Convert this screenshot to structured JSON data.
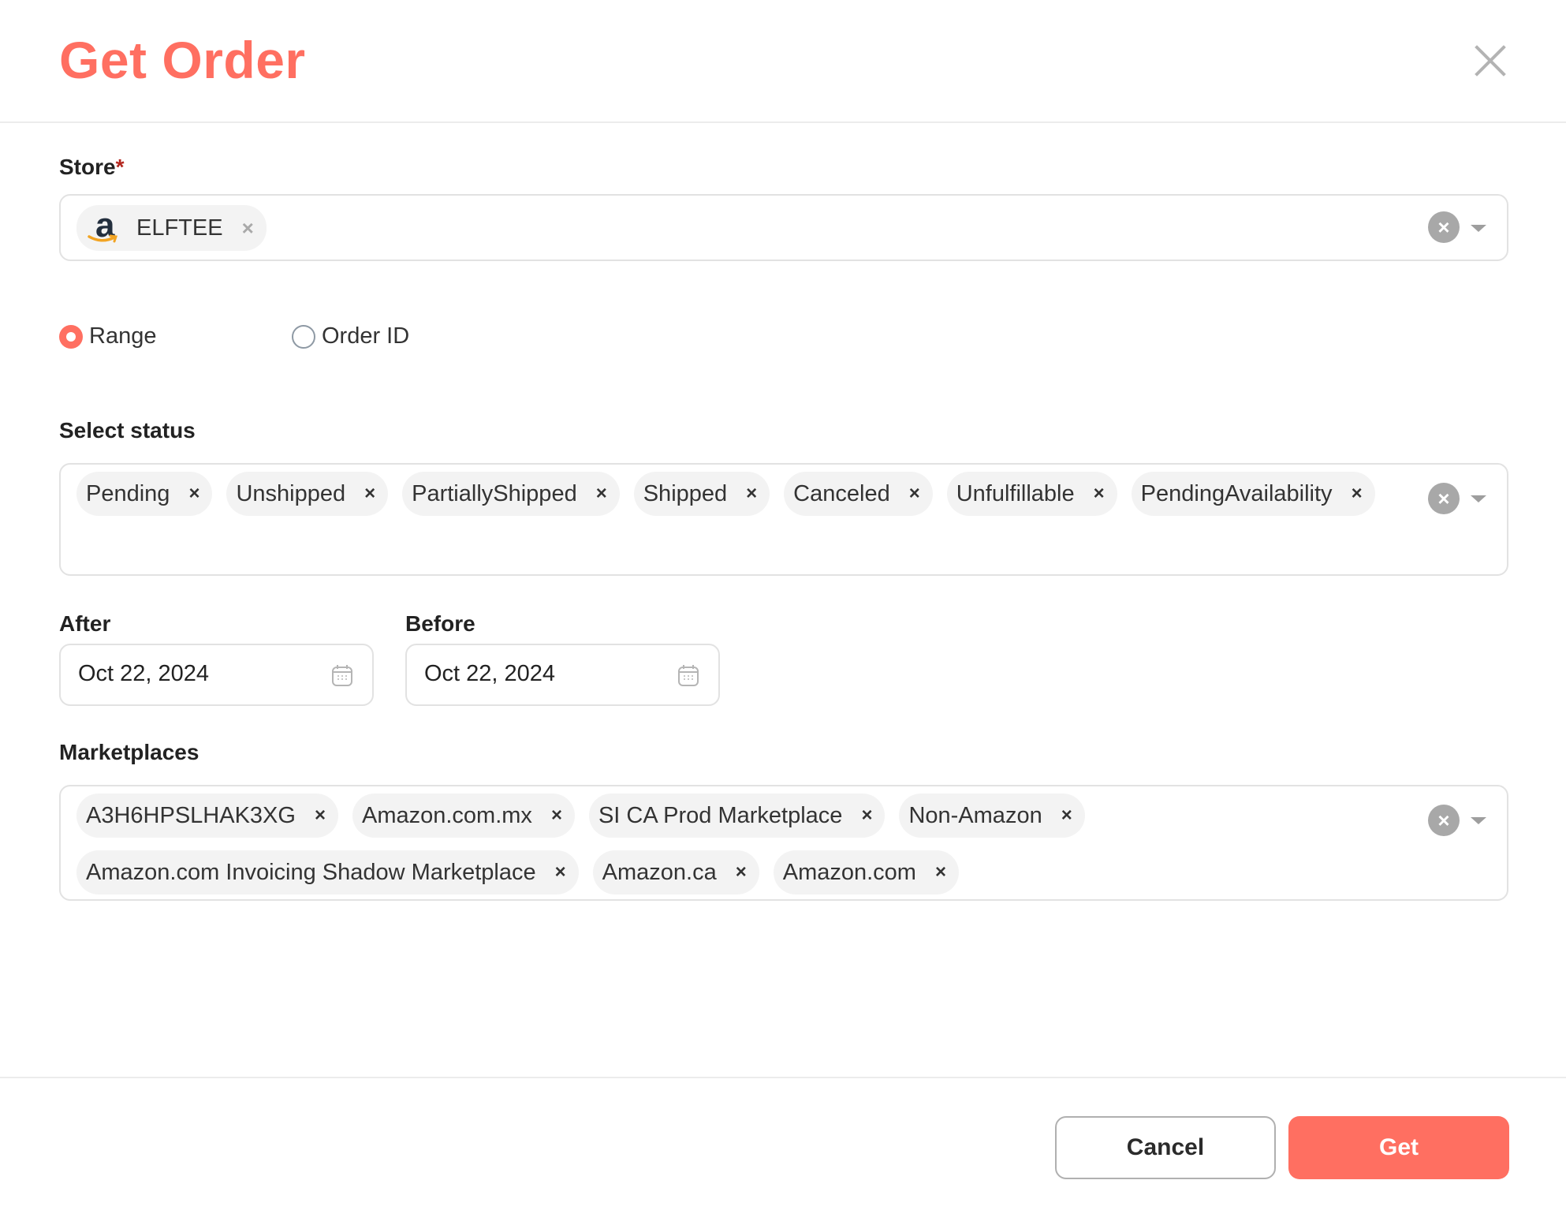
{
  "dialog": {
    "title": "Get Order",
    "close_icon": "close-icon"
  },
  "store": {
    "label": "Store",
    "required_mark": "*",
    "selected": [
      {
        "label": "ELFTEE",
        "icon": "amazon-logo-icon"
      }
    ]
  },
  "mode": {
    "options": [
      {
        "label": "Range",
        "selected": true
      },
      {
        "label": "Order ID",
        "selected": false
      }
    ]
  },
  "status": {
    "label": "Select status",
    "selected": [
      "Pending",
      "Unshipped",
      "PartiallyShipped",
      "Shipped",
      "Canceled",
      "Unfulfillable",
      "PendingAvailability"
    ]
  },
  "dates": {
    "after": {
      "label": "After",
      "value": "Oct 22, 2024",
      "icon": "calendar-icon"
    },
    "before": {
      "label": "Before",
      "value": "Oct 22, 2024",
      "icon": "calendar-icon"
    }
  },
  "marketplaces": {
    "label": "Marketplaces",
    "selected": [
      "A3H6HPSLHAK3XG",
      "Amazon.com.mx",
      "SI CA Prod Marketplace",
      "Non-Amazon",
      "Amazon.com Invoicing Shadow Marketplace",
      "Amazon.ca",
      "Amazon.com"
    ]
  },
  "chip_remove_glyph": "×",
  "clear_glyph": "×",
  "footer": {
    "cancel_label": "Cancel",
    "get_label": "Get"
  },
  "colors": {
    "accent": "#ff6f61",
    "chip_bg": "#f3f3f3",
    "border": "#e2e2e2"
  }
}
